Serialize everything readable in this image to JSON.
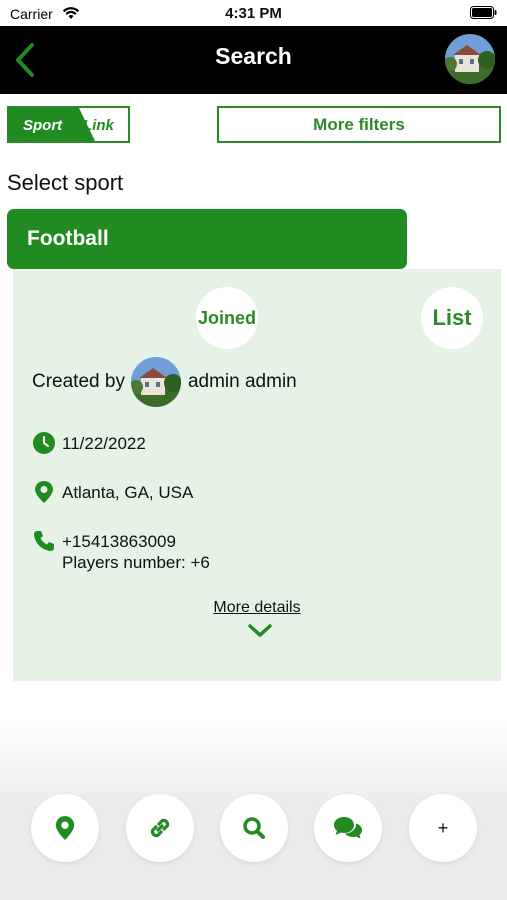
{
  "status_bar": {
    "carrier": "Carrier",
    "time": "4:31 PM"
  },
  "nav": {
    "title": "Search",
    "back_icon": "chevron-left-icon",
    "avatar": "user-avatar"
  },
  "filters": {
    "logo_text_1": "Sport",
    "logo_text_2": "Link",
    "more_filters_label": "More filters"
  },
  "select_sport_label": "Select sport",
  "sport": {
    "selected": "Football"
  },
  "event": {
    "joined_label": "Joined",
    "list_label": "List",
    "created_by_label": "Created by",
    "creator_name": "admin admin",
    "date": "11/22/2022",
    "location": "Atlanta, GA, USA",
    "phone": "+15413863009",
    "players": "Players number: +6",
    "more_details_label": "More details"
  },
  "tabs": {
    "add_label": "+"
  },
  "colors": {
    "accent": "#218a21",
    "card_bg": "#e6f2e6",
    "nav_bg": "#000000"
  }
}
